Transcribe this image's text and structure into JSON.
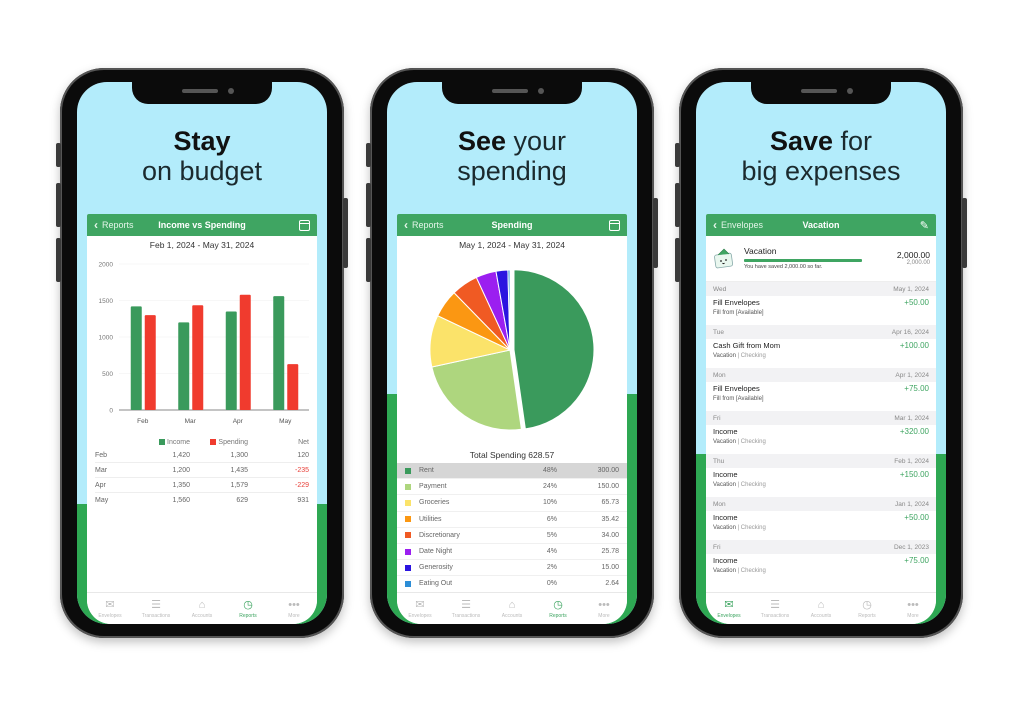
{
  "colors": {
    "green": "#3fa562",
    "sky": "#b3ecfb",
    "income": "#3a9a5c",
    "spending": "#f03b2e",
    "negative": "#e8413a"
  },
  "tabbar": {
    "items": [
      {
        "label": "Envelopes",
        "icon": "envelope-icon",
        "glyph": "✉"
      },
      {
        "label": "Transactions",
        "icon": "list-icon",
        "glyph": "☰"
      },
      {
        "label": "Accounts",
        "icon": "bank-icon",
        "glyph": "⌂"
      },
      {
        "label": "Reports",
        "icon": "clock-chart-icon",
        "glyph": "◷"
      },
      {
        "label": "More",
        "icon": "more-icon",
        "glyph": "•••"
      }
    ]
  },
  "phone1": {
    "headline_bold": "Stay",
    "headline_rest": "on budget",
    "nav": {
      "back_label": "Reports",
      "title": "Income vs Spending",
      "right_icon": "calendar-icon"
    },
    "date_range": "Feb 1, 2024 - May 31, 2024",
    "active_tab": 3,
    "legend": {
      "income": "Income",
      "spending": "Spending",
      "net": "Net"
    },
    "rows": [
      {
        "month": "Feb",
        "income": "1,420",
        "spending": "1,300",
        "net": "120",
        "negative": false
      },
      {
        "month": "Mar",
        "income": "1,200",
        "spending": "1,435",
        "net": "-235",
        "negative": true
      },
      {
        "month": "Apr",
        "income": "1,350",
        "spending": "1,579",
        "net": "-229",
        "negative": true
      },
      {
        "month": "May",
        "income": "1,560",
        "spending": "629",
        "net": "931",
        "negative": false
      }
    ]
  },
  "phone2": {
    "headline_bold": "See",
    "headline_rest1": " your",
    "headline_rest2": "spending",
    "nav": {
      "back_label": "Reports",
      "title": "Spending",
      "right_icon": "calendar-icon"
    },
    "date_range": "May 1, 2024 - May 31, 2024",
    "total_label": "Total Spending 628.57",
    "active_tab": 3,
    "categories": [
      {
        "name": "Rent",
        "pct": "48%",
        "amount": "300.00",
        "color": "#3a9a5c",
        "selected": true
      },
      {
        "name": "Payment",
        "pct": "24%",
        "amount": "150.00",
        "color": "#aed67e",
        "selected": false
      },
      {
        "name": "Groceries",
        "pct": "10%",
        "amount": "65.73",
        "color": "#fbe36a",
        "selected": false
      },
      {
        "name": "Utilities",
        "pct": "6%",
        "amount": "35.42",
        "color": "#fb9712",
        "selected": false
      },
      {
        "name": "Discretionary",
        "pct": "5%",
        "amount": "34.00",
        "color": "#f05a23",
        "selected": false
      },
      {
        "name": "Date Night",
        "pct": "4%",
        "amount": "25.78",
        "color": "#9b1ff0",
        "selected": false
      },
      {
        "name": "Generosity",
        "pct": "2%",
        "amount": "15.00",
        "color": "#2b14e0",
        "selected": false
      },
      {
        "name": "Eating Out",
        "pct": "0%",
        "amount": "2.64",
        "color": "#2c8dd6",
        "selected": false
      }
    ]
  },
  "phone3": {
    "headline_bold": "Save",
    "headline_rest1": " for",
    "headline_rest2": "big expenses",
    "nav": {
      "back_label": "Envelopes",
      "title": "Vacation",
      "right_icon": "edit-icon"
    },
    "envelope": {
      "name": "Vacation",
      "amount": "2,000.00",
      "goal": "2,000.00",
      "saved_text": "You have saved 2,000.00 so far.",
      "progress": 1.0
    },
    "active_tab": 0,
    "transactions": [
      {
        "day": "Wed",
        "date": "May 1, 2024",
        "title": "Fill Envelopes",
        "amount": "+50.00",
        "sub_main": "Fill from [Available]",
        "sub_muted": ""
      },
      {
        "day": "Tue",
        "date": "Apr 16, 2024",
        "title": "Cash Gift from Mom",
        "amount": "+100.00",
        "sub_main": "Vacation",
        "sub_muted": " | Checking"
      },
      {
        "day": "Mon",
        "date": "Apr 1, 2024",
        "title": "Fill Envelopes",
        "amount": "+75.00",
        "sub_main": "Fill from [Available]",
        "sub_muted": ""
      },
      {
        "day": "Fri",
        "date": "Mar 1, 2024",
        "title": "Income",
        "amount": "+320.00",
        "sub_main": "Vacation",
        "sub_muted": " | Checking"
      },
      {
        "day": "Thu",
        "date": "Feb 1, 2024",
        "title": "Income",
        "amount": "+150.00",
        "sub_main": "Vacation",
        "sub_muted": " | Checking"
      },
      {
        "day": "Mon",
        "date": "Jan 1, 2024",
        "title": "Income",
        "amount": "+50.00",
        "sub_main": "Vacation",
        "sub_muted": " | Checking"
      },
      {
        "day": "Fri",
        "date": "Dec 1, 2023",
        "title": "Income",
        "amount": "+75.00",
        "sub_main": "Vacation",
        "sub_muted": " | Checking"
      }
    ]
  },
  "chart_data": [
    {
      "type": "bar",
      "title": "Income vs Spending",
      "subtitle": "Feb 1, 2024 - May 31, 2024",
      "categories": [
        "Feb",
        "Mar",
        "Apr",
        "May"
      ],
      "series": [
        {
          "name": "Income",
          "values": [
            1420,
            1200,
            1350,
            1560
          ],
          "color": "#3a9a5c"
        },
        {
          "name": "Spending",
          "values": [
            1300,
            1435,
            1579,
            629
          ],
          "color": "#f03b2e"
        }
      ],
      "xlabel": "",
      "ylabel": "",
      "ylim": [
        0,
        2000
      ],
      "yticks": [
        0,
        500,
        1000,
        1500,
        2000
      ],
      "grid": true,
      "legend": "bottom"
    },
    {
      "type": "pie",
      "title": "Spending",
      "subtitle": "May 1, 2024 - May 31, 2024",
      "labels": [
        "Rent",
        "Payment",
        "Groceries",
        "Utilities",
        "Discretionary",
        "Date Night",
        "Generosity",
        "Eating Out"
      ],
      "values": [
        300.0,
        150.0,
        65.73,
        35.42,
        34.0,
        25.78,
        15.0,
        2.64
      ],
      "colors": [
        "#3a9a5c",
        "#aed67e",
        "#fbe36a",
        "#fb9712",
        "#f05a23",
        "#9b1ff0",
        "#2b14e0",
        "#2c8dd6"
      ],
      "total": 628.57,
      "exploded": "Rent",
      "legend": "bottom"
    }
  ]
}
